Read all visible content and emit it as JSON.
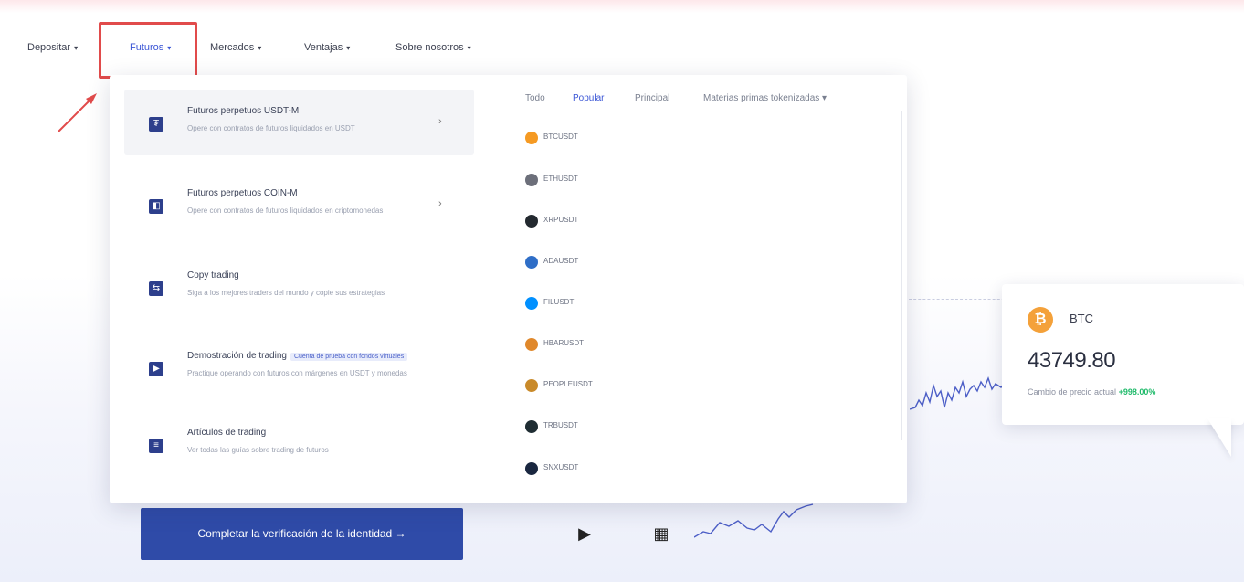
{
  "nav": {
    "items": [
      {
        "label": "Depositar",
        "caret": "▾"
      },
      {
        "label": "Futuros",
        "caret": "▾"
      },
      {
        "label": "Mercados",
        "caret": "▾"
      },
      {
        "label": "Ventajas",
        "caret": "▾"
      },
      {
        "label": "Sobre nosotros",
        "caret": "▾"
      }
    ]
  },
  "dropdown": {
    "menu": [
      {
        "title": "Futuros perpetuos USDT-M",
        "desc": "Opere con contratos de futuros liquidados en USDT",
        "icon": "futures-usdt-icon",
        "glyph": "₮",
        "arrow": "›"
      },
      {
        "title": "Futuros perpetuos COIN-M",
        "desc": "Opere con contratos de futuros liquidados en criptomonedas",
        "icon": "futures-coin-icon",
        "glyph": "◧",
        "arrow": "›"
      },
      {
        "title": "Copy trading",
        "desc": "Siga a los mejores traders del mundo y copie sus estrategias",
        "icon": "copy-trading-icon",
        "glyph": "⇆",
        "arrow": ""
      },
      {
        "title": "Demostración de trading",
        "tag": "Cuenta de prueba con fondos virtuales",
        "desc": "Practique operando con futuros con márgenes en USDT y monedas",
        "icon": "demo-trading-icon",
        "glyph": "▶",
        "arrow": ""
      },
      {
        "title": "Artículos de trading",
        "desc": "Ver todas las guías sobre trading de futuros",
        "icon": "articles-icon",
        "glyph": "≡",
        "arrow": ""
      }
    ],
    "filters": [
      "Todo",
      "Popular",
      "Principal",
      "Materias primas tokenizadas ▾"
    ],
    "pairs": [
      {
        "name": "BTCUSDT",
        "color": "#f59a23"
      },
      {
        "name": "ETHUSDT",
        "color": "#6c6f7a"
      },
      {
        "name": "XRPUSDT",
        "color": "#23292f"
      },
      {
        "name": "ADAUSDT",
        "color": "#2f6ec7"
      },
      {
        "name": "FILUSDT",
        "color": "#0090ff"
      },
      {
        "name": "HBARUSDT",
        "color": "#e0882b"
      },
      {
        "name": "PEOPLEUSDT",
        "color": "#c98a2a"
      },
      {
        "name": "TRBUSDT",
        "color": "#1f2d33"
      },
      {
        "name": "SNXUSDT",
        "color": "#1a2740"
      }
    ]
  },
  "price_card": {
    "symbol": "BTC",
    "coin_glyph": "₿",
    "price": "43749.80",
    "change_label": "Cambio de precio actual",
    "change_value": "+998.00%"
  },
  "cta": {
    "label": "Completar la verificación de la identidad →"
  },
  "apps": [
    {
      "name": "apple-icon",
      "glyph": ""
    },
    {
      "name": "google-play-icon",
      "glyph": "▶"
    },
    {
      "name": "qr-code-icon",
      "glyph": "▦"
    }
  ],
  "colors": {
    "accent": "#3b56d6",
    "brand_button": "#2f4ba8",
    "highlight": "#e14b4b",
    "positive": "#1fba6a"
  }
}
